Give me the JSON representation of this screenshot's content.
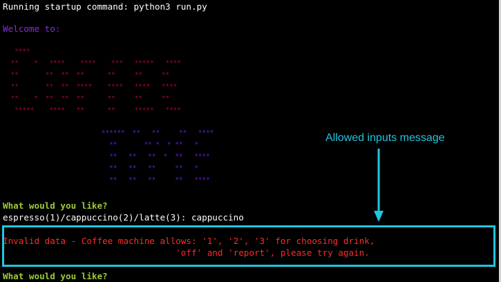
{
  "colors": {
    "terminal_bg": "#000000",
    "system_text": "#ffffff",
    "welcome_text": "#8a2be2",
    "prompt_text": "#9acd32",
    "error_text": "#ff2a2a",
    "art_coffee": "#b2004a",
    "art_time": "#6a1fd8",
    "annotation": "#1fc7e0"
  },
  "terminal": {
    "startup_line": "Running startup command: python3 run.py",
    "welcome": "Welcome to:",
    "art_coffee_lines": [
      "  ****",
      " **    *   ****    ****    ***   *****   ****",
      " **       **  **  **      **     **     **",
      " **       **  **  ****    ****   ****   ****",
      " **    *  **  **  **      **     **     **",
      "  *****    ****   **      **     *****   ****"
    ],
    "art_time_lines": [
      "******  **   **     **   ****",
      "  **       ** *  * **   *",
      "  **   **   **  *  **   ****",
      "  **   **   **     **   *",
      "  **   **   **     **   ****"
    ],
    "prompt_question": "What would you like?",
    "prompt_options": "espresso(1)/cappuccino(2)/latte(3): cappuccino",
    "error_line_1": "Invalid data - Coffee machine allows: '1', '2', '3' for choosing drink,",
    "error_line_2": "                                 'off' and 'report', please try again.",
    "prompt_question_again": "What would you like?"
  },
  "annotation": {
    "label": "Allowed inputs message"
  }
}
